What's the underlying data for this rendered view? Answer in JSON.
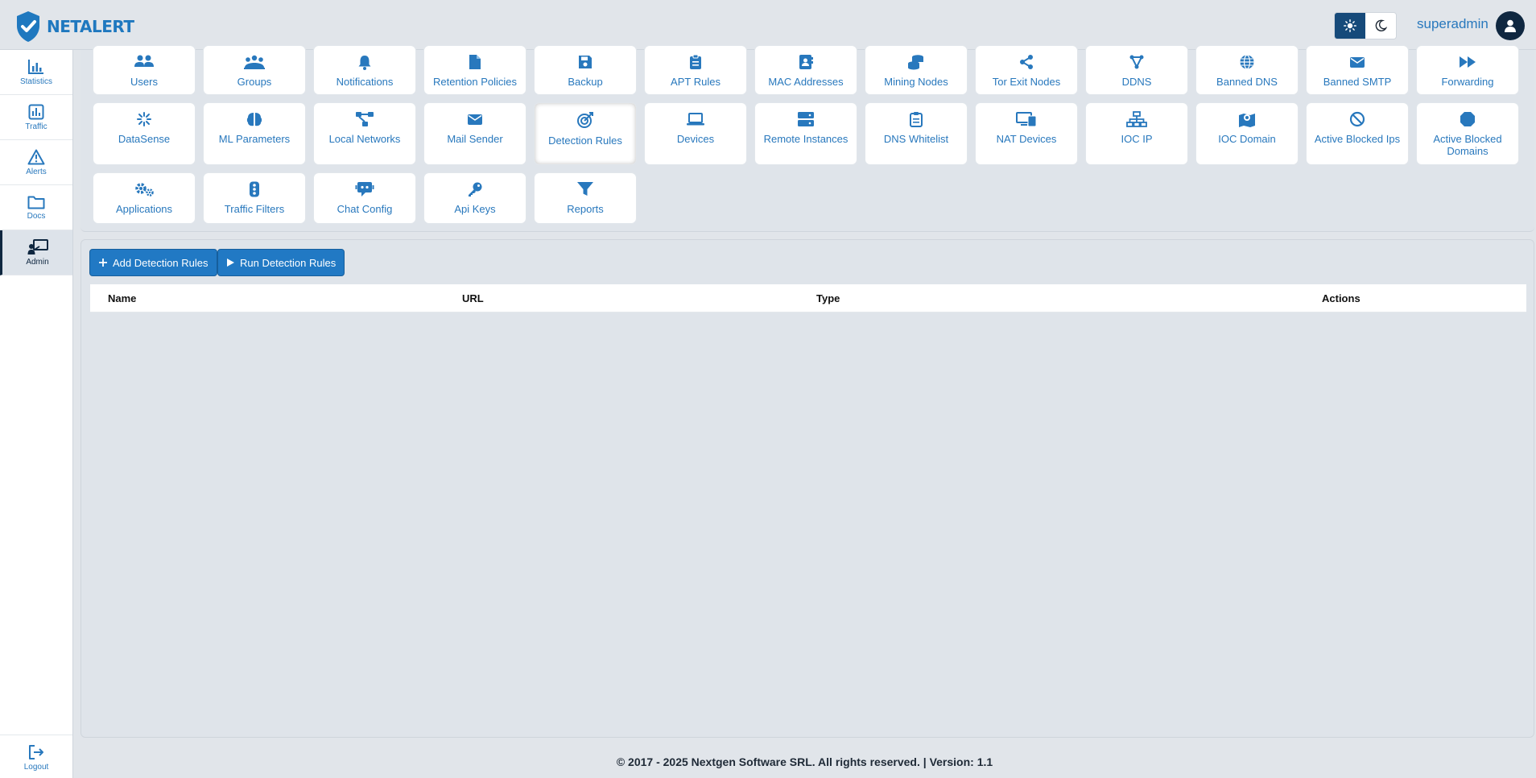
{
  "app": {
    "logo_text": "NETALERT"
  },
  "header": {
    "username": "superadmin"
  },
  "sidebar": {
    "items": [
      {
        "label": "Statistics",
        "icon": "chart-bar-icon"
      },
      {
        "label": "Traffic",
        "icon": "chart-square-icon"
      },
      {
        "label": "Alerts",
        "icon": "warning-icon"
      },
      {
        "label": "Docs",
        "icon": "folder-icon"
      },
      {
        "label": "Admin",
        "icon": "admin-presentation-icon"
      }
    ],
    "logout_label": "Logout"
  },
  "admin_tiles": {
    "row1": [
      "Users",
      "Groups",
      "Notifications",
      "Retention Policies",
      "Backup",
      "APT Rules",
      "MAC Addresses",
      "Mining Nodes",
      "Tor Exit Nodes",
      "DDNS",
      "Banned DNS",
      "Banned SMTP",
      "Forwarding"
    ],
    "row2": [
      "DataSense",
      "ML Parameters",
      "Local Networks",
      "Mail Sender",
      "Detection Rules",
      "Devices",
      "Remote Instances",
      "DNS Whitelist",
      "NAT Devices",
      "IOC IP",
      "IOC Domain",
      "Active Blocked Ips",
      "Active Blocked Domains"
    ],
    "row3": [
      "Applications",
      "Traffic Filters",
      "Chat Config",
      "Api Keys",
      "Reports"
    ],
    "active": "Detection Rules"
  },
  "toolbar": {
    "add_label": "Add Detection Rules",
    "run_label": "Run Detection Rules"
  },
  "table": {
    "columns": [
      "Name",
      "URL",
      "Type",
      "Actions"
    ]
  },
  "footer": {
    "text": "© 2017 - 2025 Nextgen Software SRL. All rights reserved. | Version: 1.1"
  },
  "colors": {
    "accent": "#2179c4",
    "dark": "#0f2740",
    "background": "#e1e5ea"
  }
}
